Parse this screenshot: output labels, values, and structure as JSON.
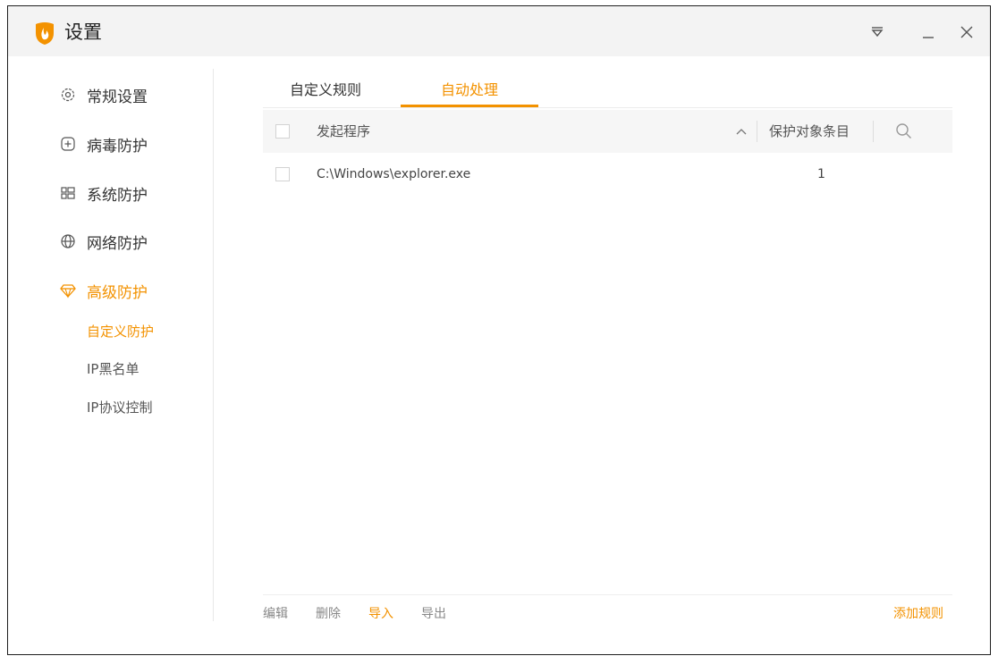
{
  "window": {
    "title": "设置",
    "accent_color": "#f39200",
    "controls": [
      "menu-icon",
      "minimize-icon",
      "close-icon"
    ]
  },
  "sidebar": {
    "items": [
      {
        "label": "常规设置",
        "icon": "gear-icon"
      },
      {
        "label": "病毒防护",
        "icon": "plus-square-icon"
      },
      {
        "label": "系统防护",
        "icon": "grid-icon"
      },
      {
        "label": "网络防护",
        "icon": "globe-icon"
      },
      {
        "label": "高级防护",
        "icon": "diamond-icon",
        "active": true
      }
    ],
    "subitems": [
      {
        "label": "自定义防护",
        "active": true
      },
      {
        "label": "IP黑名单"
      },
      {
        "label": "IP协议控制"
      }
    ]
  },
  "tabs": [
    {
      "label": "自定义规则"
    },
    {
      "label": "自动处理",
      "active": true
    }
  ],
  "table": {
    "columns": [
      "发起程序",
      "保护对象条目"
    ],
    "sort_indicator": "^",
    "rows": [
      {
        "program": "C:\\Windows\\explorer.exe",
        "count": "1"
      }
    ]
  },
  "footer": {
    "edit": "编辑",
    "delete": "删除",
    "import": "导入",
    "export": "导出",
    "add_rule": "添加规则"
  }
}
